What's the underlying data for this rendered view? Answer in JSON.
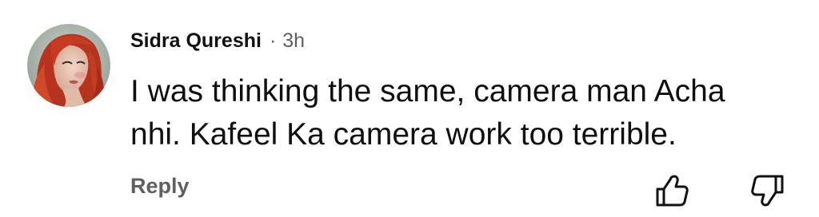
{
  "comment": {
    "author": "Sidra Qureshi",
    "separator": "·",
    "time": "3h",
    "text_lines": [
      "I was thinking the same, camera man Acha",
      "nhi. Kafeel Ka camera work too terrible."
    ],
    "reply_label": "Reply",
    "icons": {
      "like": "thumbs-up-icon",
      "dislike": "thumbs-down-icon"
    }
  },
  "colors": {
    "text_primary": "#0f0f0f",
    "text_secondary": "#606060",
    "background": "#ffffff"
  }
}
